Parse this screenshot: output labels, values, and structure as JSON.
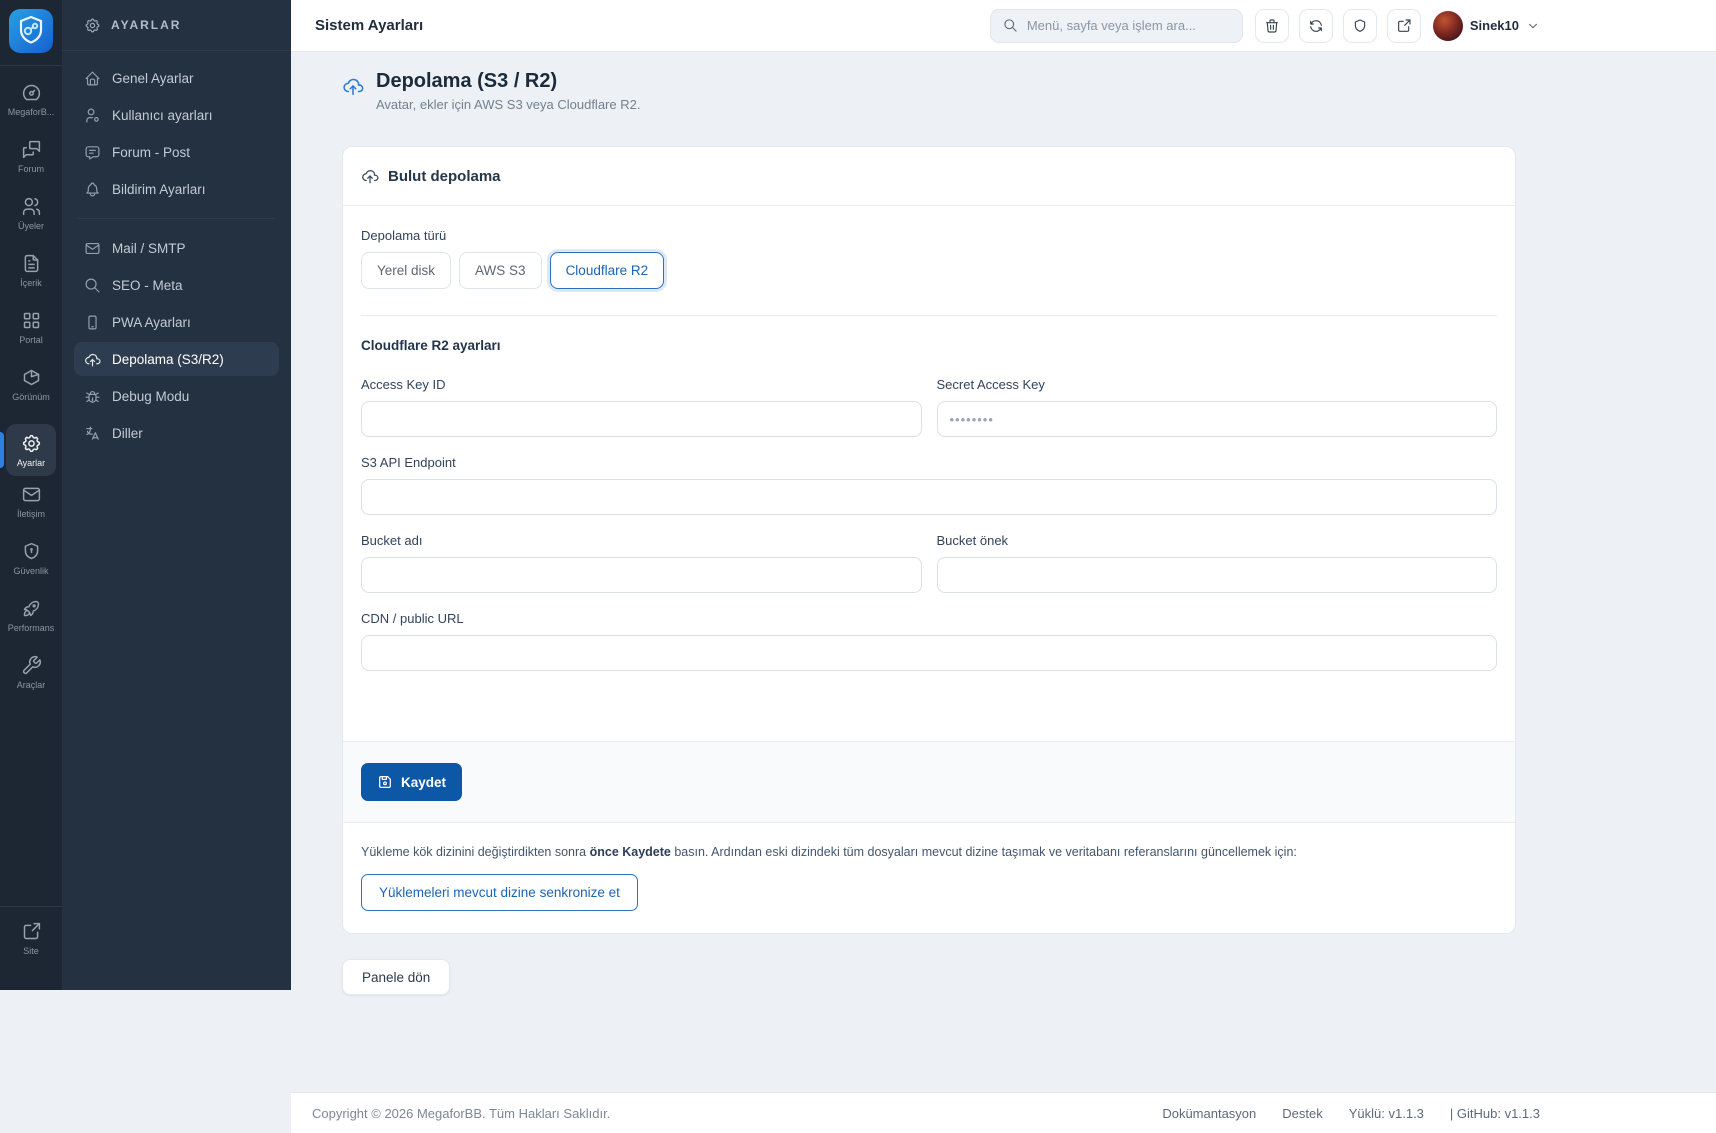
{
  "rail": {
    "items": [
      {
        "label": "MegaforB...",
        "icon": "dashboard-icon"
      },
      {
        "label": "Forum",
        "icon": "forum-icon"
      },
      {
        "label": "Üyeler",
        "icon": "members-icon"
      },
      {
        "label": "İçerik",
        "icon": "content-icon"
      },
      {
        "label": "Portal",
        "icon": "portal-icon"
      },
      {
        "label": "Görünüm",
        "icon": "appearance-icon"
      },
      {
        "label": "Ayarlar",
        "icon": "gear-icon",
        "active": true
      },
      {
        "label": "İletişim",
        "icon": "mail-icon"
      },
      {
        "label": "Güvenlik",
        "icon": "shield-icon"
      },
      {
        "label": "Performans",
        "icon": "rocket-icon"
      },
      {
        "label": "Araçlar",
        "icon": "wrench-icon"
      }
    ],
    "bottom_item": {
      "label": "Site",
      "icon": "external-link-icon"
    }
  },
  "sidebar": {
    "header": "AYARLAR",
    "groups": [
      {
        "items": [
          {
            "label": "Genel Ayarlar"
          },
          {
            "label": "Kullanıcı ayarları"
          },
          {
            "label": "Forum - Post"
          },
          {
            "label": "Bildirim Ayarları"
          }
        ]
      },
      {
        "items": [
          {
            "label": "Mail / SMTP"
          },
          {
            "label": "SEO - Meta"
          },
          {
            "label": "PWA Ayarları"
          },
          {
            "label": "Depolama (S3/R2)",
            "active": true
          },
          {
            "label": "Debug Modu"
          },
          {
            "label": "Diller"
          }
        ]
      }
    ]
  },
  "topbar": {
    "title": "Sistem Ayarları",
    "search_placeholder": "Menü, sayfa veya işlem ara...",
    "user_name": "Sinek10"
  },
  "page": {
    "title": "Depolama (S3 / R2)",
    "subtitle": "Avatar, ekler için AWS S3 veya Cloudflare R2."
  },
  "card": {
    "header": "Bulut depolama",
    "storage_type_label": "Depolama türü",
    "storage_options": [
      {
        "label": "Yerel disk"
      },
      {
        "label": "AWS S3"
      },
      {
        "label": "Cloudflare R2",
        "selected": true
      }
    ],
    "section_title": "Cloudflare R2 ayarları",
    "fields": {
      "access_key": {
        "label": "Access Key ID",
        "value": "",
        "placeholder": ""
      },
      "secret_key": {
        "label": "Secret Access Key",
        "value": "",
        "placeholder": "••••••••"
      },
      "endpoint": {
        "label": "S3 API Endpoint",
        "value": "",
        "placeholder": ""
      },
      "bucket_name": {
        "label": "Bucket adı",
        "value": "",
        "placeholder": ""
      },
      "bucket_prefix": {
        "label": "Bucket önek",
        "value": "",
        "placeholder": ""
      },
      "cdn_url": {
        "label": "CDN / public URL",
        "value": "",
        "placeholder": ""
      }
    },
    "save_label": "Kaydet",
    "note": {
      "part1": "Yükleme kök dizinini değiştirdikten sonra ",
      "bold": "önce Kaydete",
      "part2": " basın. Ardından eski dizindeki tüm dosyaları mevcut dizine taşımak ve veritabanı referanslarını güncellemek için:"
    },
    "sync_button_label": "Yüklemeleri mevcut dizine senkronize et"
  },
  "back_label": "Panele dön",
  "footer": {
    "copyright": "Copyright © 2026 MegaforBB. Tüm Hakları Saklıdır.",
    "links": [
      "Dokümantasyon",
      "Destek",
      "Yüklü: v1.1.3",
      "| GitHub: v1.1.3"
    ]
  },
  "colors": {
    "accent_blue": "#1a64b4",
    "save_button": "#0d57a7",
    "rail_bg": "#1d2734",
    "sidebar_bg": "#243140",
    "active_indicator": "#2f81e0",
    "content_bg": "#edf0f4"
  }
}
